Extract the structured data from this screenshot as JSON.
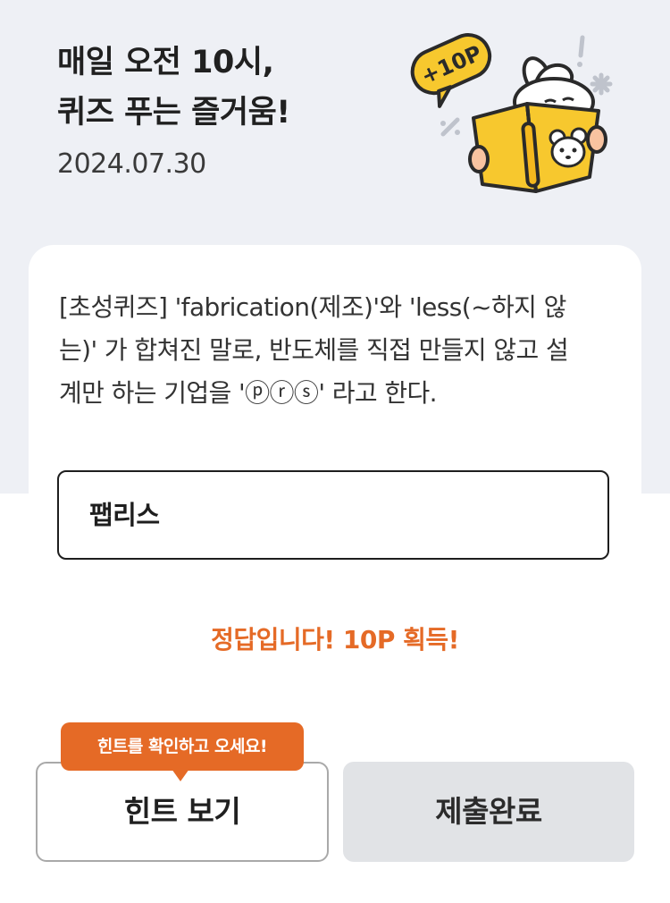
{
  "header": {
    "title_line1": "매일 오전 10시,",
    "title_line2": "퀴즈 푸는 즐거움!",
    "date": "2024.07.30"
  },
  "illustration": {
    "badge": "+10P",
    "icon": "bunny-reading-book-illustration"
  },
  "quiz": {
    "question_line1": "[초성퀴즈] 'fabrication(제조)'와 'less(~하지 않",
    "question_line2": "는)' 가 합쳐진 말로, 반도체를 직접 만들지 않고 설",
    "question_line3": "계만 하는 기업을 'ⓟⓡⓢ' 라고 한다.",
    "answer_value": "팹리스",
    "result_message": "정답입니다! 10P 획득!"
  },
  "buttons": {
    "hint_tooltip": "힌트를 확인하고 오세요!",
    "hint_label": "힌트 보기",
    "submit_label": "제출완료"
  },
  "colors": {
    "accent": "#e56a26",
    "header_bg": "#eef0f5",
    "disabled_button": "#e1e3e6"
  }
}
